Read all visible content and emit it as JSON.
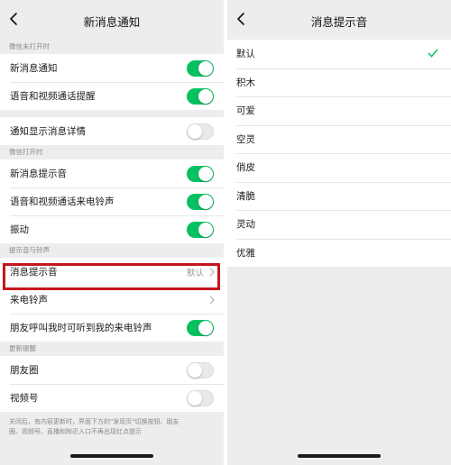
{
  "left": {
    "title": "新消息通知",
    "section_closed": "微信未打开时",
    "row_new_message": "新消息通知",
    "row_call_alert": "语音和视频通话提醒",
    "row_show_details": "通知显示消息详情",
    "section_open": "微信打开时",
    "row_message_sound": "新消息提示音",
    "row_call_ringtone": "语音和视频通话来电铃声",
    "row_vibrate": "振动",
    "section_sounds": "提示音与铃声",
    "row_notification_sound": "消息提示音",
    "notification_sound_value": "默认",
    "row_incoming_ringtone": "来电铃声",
    "row_friend_hear_ringtone": "朋友呼叫我时可听到我的来电铃声",
    "section_updates": "更新提醒",
    "row_moments": "朋友圈",
    "row_channels": "视频号",
    "footer_line1": "关闭后，有内容更新时，界面下方的\"发现页\"切换按钮、朋友",
    "footer_line2": "圈、视频号、直播和附近入口不再出现红点提示",
    "toggles": {
      "new_message": true,
      "call_alert": true,
      "show_details": false,
      "message_sound": true,
      "call_ringtone": true,
      "vibrate": true,
      "friend_hear_ringtone": true,
      "moments": false,
      "channels": false
    }
  },
  "right": {
    "title": "消息提示音",
    "options": [
      "默认",
      "积木",
      "可爱",
      "空灵",
      "俏皮",
      "清脆",
      "灵动",
      "优雅"
    ],
    "selected_index": 0
  },
  "colors": {
    "accent_green": "#07c160",
    "highlight_red": "#c5161d",
    "background": "#ededed"
  },
  "icons": [
    "back-icon",
    "chevron-right-icon",
    "checkmark-icon"
  ]
}
